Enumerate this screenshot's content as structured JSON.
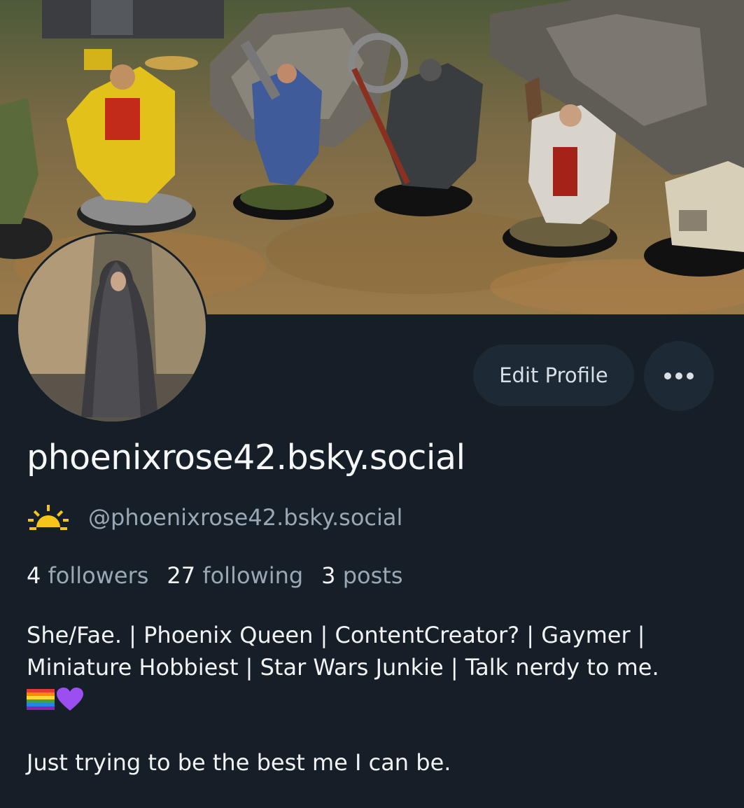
{
  "profile": {
    "display_name": "phoenixrose42.bsky.social",
    "handle": "@phoenixrose42.bsky.social",
    "status_icon": "sun-icon"
  },
  "actions": {
    "edit_profile_label": "Edit Profile",
    "more_icon": "ellipsis-icon"
  },
  "stats": {
    "followers_count": "4",
    "followers_label": "followers",
    "following_count": "27",
    "following_label": "following",
    "posts_count": "3",
    "posts_label": "posts"
  },
  "bio": {
    "line1": "She/Fae. | Phoenix Queen | ContentCreator? | Gaymer |",
    "line2": "Miniature Hobbiest | Star Wars Junkie | Talk nerdy to me.",
    "emojis": [
      "rainbow-flag-icon",
      "purple-heart-icon"
    ],
    "tagline": "Just trying to be the best me I can be."
  },
  "colors": {
    "background": "#161e27",
    "button_bg": "#1e2936",
    "muted_text": "#9aa8b6",
    "sun_icon": "#f5c518"
  }
}
